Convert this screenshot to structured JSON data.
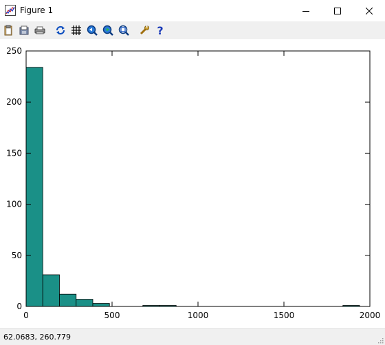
{
  "window": {
    "title": "Figure 1"
  },
  "toolbar": {
    "buttons": [
      {
        "name": "copy-icon"
      },
      {
        "name": "save-icon"
      },
      {
        "name": "print-icon"
      },
      {
        "name": "refresh-icon"
      },
      {
        "name": "grid-icon"
      },
      {
        "name": "zoom-in-icon"
      },
      {
        "name": "zoom-out-icon"
      },
      {
        "name": "zoom-fit-icon"
      },
      {
        "name": "settings-icon"
      },
      {
        "name": "help-icon"
      }
    ]
  },
  "status": {
    "coords": "62.0683,  260.779"
  },
  "chart_data": {
    "type": "bar",
    "title": "",
    "xlabel": "",
    "ylabel": "",
    "xlim": [
      0,
      2000
    ],
    "ylim": [
      0,
      250
    ],
    "xticks": [
      "0",
      "500",
      "1000",
      "1500",
      "2000"
    ],
    "yticks": [
      "0",
      "50",
      "100",
      "150",
      "200",
      "250"
    ],
    "bar_color": "#1a9087",
    "bin_edges": [
      0,
      97,
      194,
      291,
      388,
      485,
      582,
      679,
      776,
      873,
      970,
      1067,
      1164,
      1261,
      1358,
      1455,
      1552,
      1649,
      1746,
      1843,
      1940
    ],
    "values": [
      234,
      31,
      12,
      7,
      3,
      0,
      0,
      1,
      1,
      0,
      0,
      0,
      0,
      0,
      0,
      0,
      0,
      0,
      0,
      1
    ]
  }
}
